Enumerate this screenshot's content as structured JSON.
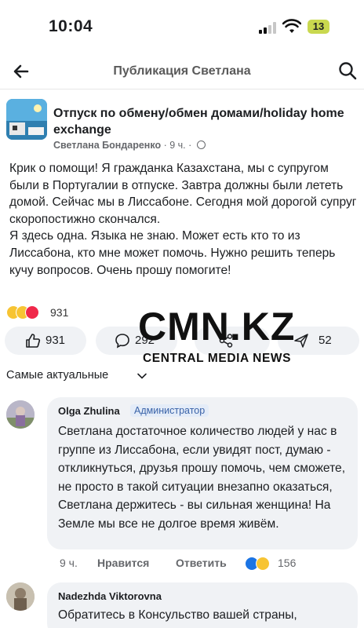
{
  "status_bar": {
    "time": "10:04",
    "battery": "13"
  },
  "nav": {
    "title": "Публикация Светлана"
  },
  "post": {
    "group_name": "Отпуск по обмену/обмен домами/holiday home exchange",
    "author": "Светлана Бондаренко",
    "time": "9 ч.",
    "body": "Крик о помощи! Я гражданка Казахстана, мы с супругом были в Португалии  в отпуске. Завтра должны были лететь домой. Сейчас мы в Лиссабоне. Сегодня мой дорогой супруг скоропостижно скончался.\nЯ здесь одна. Языка не знаю. Может есть кто то из Лиссабона, кто мне может помочь.  Нужно решить теперь кучу вопросов.  Очень прошу помогите!",
    "reaction_count": "931",
    "like_count": "931",
    "comment_count": "292",
    "send_count": "52"
  },
  "watermark": {
    "logo": "CMN.KZ",
    "subtitle": "CENTRAL MEDIA NEWS"
  },
  "comments_sort": {
    "label": "Самые актуальные"
  },
  "comments": [
    {
      "author": "Olga Zhulina",
      "badge": "Администратор",
      "text": "Светлана достаточное количество людей у нас в группе из Лиссабона, если увидят пост, думаю - откликнуться, друзья прошу помочь, чем сможете, не просто в такой ситуации внезапно оказаться, Светлана держитесь - вы сильная женщина! На Земле мы все не долгое время живём.",
      "time": "9 ч.",
      "like_label": "Нравится",
      "reply_label": "Ответить",
      "reaction_count": "156"
    },
    {
      "author": "Nadezhda Viktorovna",
      "text": "Обратитесь в Консульство вашей страны,"
    }
  ],
  "icons": {
    "back": "back-arrow-icon",
    "search": "search-icon",
    "like": "thumbs-up-icon",
    "comment": "comment-bubble-icon",
    "share": "share-icon",
    "send": "send-icon"
  },
  "colors": {
    "like_blue": "#1b74e4",
    "heart_red": "#f0284a",
    "reaction_yellow": "#f7c433",
    "battery": "#c9d84f"
  }
}
